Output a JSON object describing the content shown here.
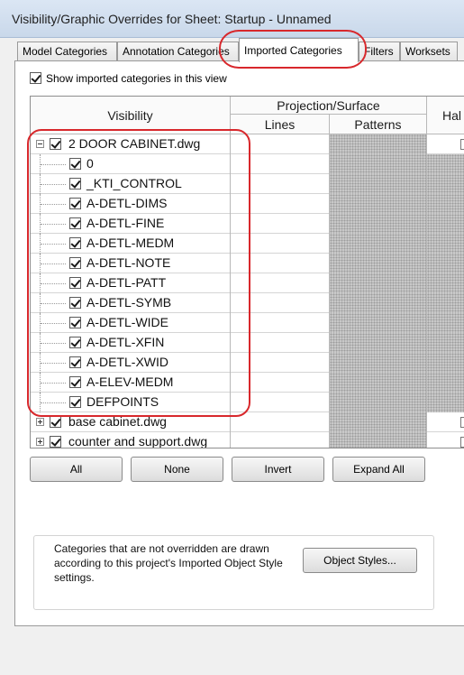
{
  "window": {
    "title": "Visibility/Graphic Overrides for Sheet: Startup - Unnamed"
  },
  "tabs": [
    {
      "label": "Model Categories"
    },
    {
      "label": "Annotation Categories"
    },
    {
      "label": "Imported Categories",
      "active": true
    },
    {
      "label": "Filters"
    },
    {
      "label": "Worksets"
    }
  ],
  "show_imported": {
    "label": "Show imported categories in this view",
    "checked": true
  },
  "grid": {
    "headers": {
      "visibility": "Visibility",
      "projection_surface": "Projection/Surface",
      "lines": "Lines",
      "patterns": "Patterns",
      "halftone": "Hal"
    },
    "rows": [
      {
        "label": "2 DOOR CABINET.dwg",
        "level": 0,
        "expander": "minus",
        "checked": true
      },
      {
        "label": "0",
        "level": 1,
        "checked": true
      },
      {
        "label": "_KTI_CONTROL",
        "level": 1,
        "checked": true
      },
      {
        "label": "A-DETL-DIMS",
        "level": 1,
        "checked": true
      },
      {
        "label": "A-DETL-FINE",
        "level": 1,
        "checked": true
      },
      {
        "label": "A-DETL-MEDM",
        "level": 1,
        "checked": true
      },
      {
        "label": "A-DETL-NOTE",
        "level": 1,
        "checked": true
      },
      {
        "label": "A-DETL-PATT",
        "level": 1,
        "checked": true
      },
      {
        "label": "A-DETL-SYMB",
        "level": 1,
        "checked": true
      },
      {
        "label": "A-DETL-WIDE",
        "level": 1,
        "checked": true
      },
      {
        "label": "A-DETL-XFIN",
        "level": 1,
        "checked": true
      },
      {
        "label": "A-DETL-XWID",
        "level": 1,
        "checked": true
      },
      {
        "label": "A-ELEV-MEDM",
        "level": 1,
        "checked": true
      },
      {
        "label": "DEFPOINTS",
        "level": 1,
        "checked": true
      },
      {
        "label": "base cabinet.dwg",
        "level": 0,
        "expander": "plus",
        "checked": true
      },
      {
        "label": "counter and support.dwg",
        "level": 0,
        "expander": "plus",
        "checked": true
      }
    ]
  },
  "buttons": {
    "all": "All",
    "none": "None",
    "invert": "Invert",
    "expand_all": "Expand All"
  },
  "info": {
    "text": "Categories that are not overridden are drawn according to this project's Imported Object Style settings.",
    "object_styles_button": "Object Styles..."
  },
  "colors": {
    "annotation_red": "#d8282c",
    "checkbox_border": "#5a5a5a"
  }
}
